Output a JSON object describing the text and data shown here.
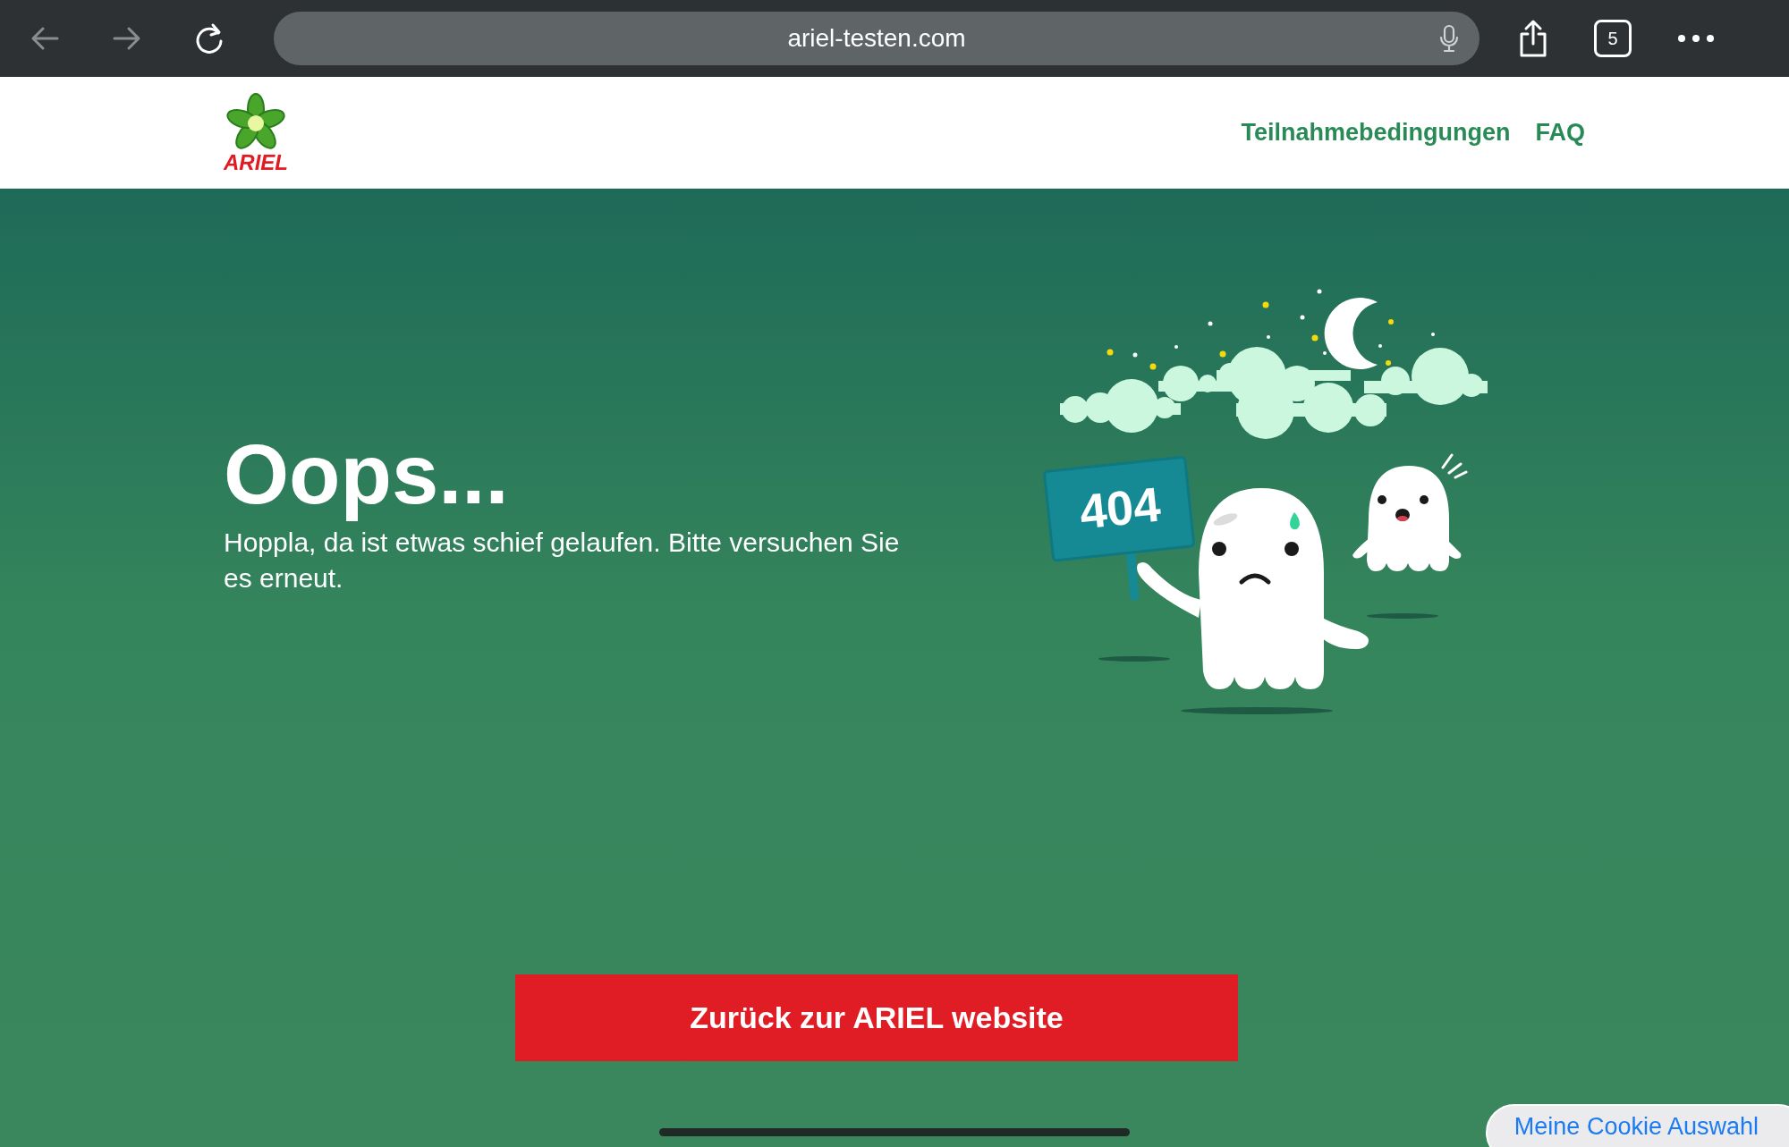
{
  "browser": {
    "url": "ariel-testen.com",
    "tab_count": "5"
  },
  "header": {
    "logo_text": "ARIEL",
    "nav": [
      "Teilnahmebedingungen",
      "FAQ"
    ]
  },
  "error": {
    "title": "Oops...",
    "message": "Hoppla, da ist etwas schief gelaufen. Bitte versuchen Sie es erneut.",
    "sign_text": "404"
  },
  "button": "Zurück zur ARIEL website",
  "cookie_button": "Meine Cookie Auswahl"
}
